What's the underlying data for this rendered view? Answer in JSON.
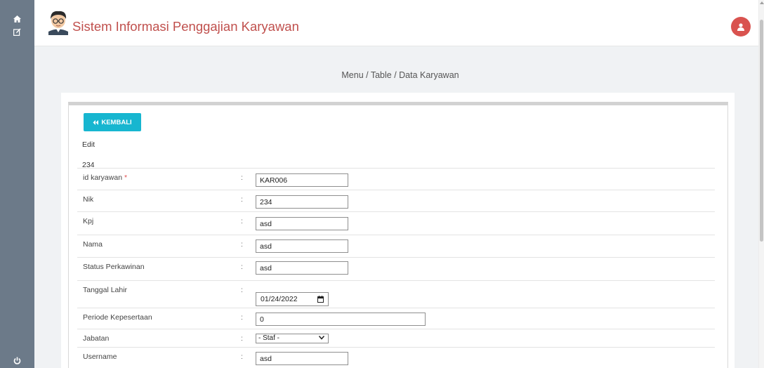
{
  "sidebar": {
    "items": [
      {
        "icon": "home-icon",
        "label": ""
      },
      {
        "icon": "edit-icon",
        "label": ""
      },
      {
        "icon": "power-icon",
        "label": ""
      }
    ]
  },
  "header": {
    "title": "Sistem Informasi Penggajian Karyawan",
    "title_color": "#c0504d",
    "user_icon": "user-icon"
  },
  "breadcrumb": "Menu / Table / Data Karyawan",
  "form": {
    "back_label": "KEMBALI",
    "back_color": "#17b6d0",
    "mode_label": "Edit",
    "record_caption": "234",
    "fields": [
      {
        "label": "id karyawan",
        "required": "*",
        "value": "KAR006",
        "type": "text"
      },
      {
        "label": "Nik",
        "value": "234",
        "type": "text"
      },
      {
        "label": "Kpj",
        "value": "asd",
        "type": "text"
      },
      {
        "label": "Nama",
        "value": "asd",
        "type": "text"
      },
      {
        "label": "Status Perkawinan",
        "value": "asd",
        "type": "text"
      },
      {
        "label": "Tanggal Lahir",
        "value": "01/24/2022",
        "type": "date"
      },
      {
        "label": "Periode Kepesertaan",
        "value": "0",
        "type": "text"
      },
      {
        "label": "Jabatan",
        "value": "- Staf -",
        "type": "select"
      },
      {
        "label": "Username",
        "value": "asd",
        "type": "text"
      }
    ]
  }
}
